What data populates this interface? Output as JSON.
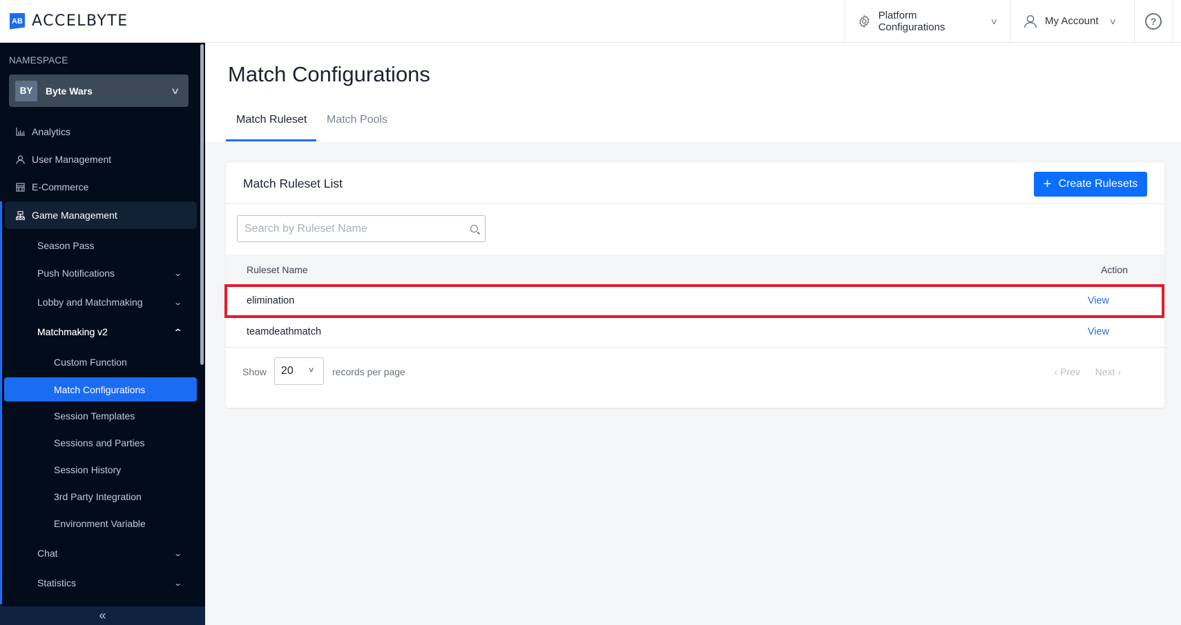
{
  "app": {
    "brand": "ACCELBYTE",
    "logo_mark": "AB"
  },
  "topbar": {
    "platform_configurations": "Platform Configurations",
    "my_account": "My Account",
    "help_icon": "?"
  },
  "sidebar": {
    "namespace_label": "NAMESPACE",
    "namespace": {
      "badge": "BY",
      "name": "Byte Wars"
    },
    "items": [
      {
        "label": "Analytics",
        "icon": "chart-icon"
      },
      {
        "label": "User Management",
        "icon": "user-icon"
      },
      {
        "label": "E-Commerce",
        "icon": "store-icon"
      },
      {
        "label": "Game Management",
        "icon": "sitemap-icon"
      }
    ],
    "game_management": [
      {
        "label": "Season Pass"
      },
      {
        "label": "Push Notifications"
      },
      {
        "label": "Lobby and Matchmaking"
      },
      {
        "label": "Matchmaking v2"
      },
      {
        "label": "Chat"
      },
      {
        "label": "Statistics"
      }
    ],
    "matchmaking_v2": [
      {
        "label": "Custom Function"
      },
      {
        "label": "Match Configurations"
      },
      {
        "label": "Session Templates"
      },
      {
        "label": "Sessions and Parties"
      },
      {
        "label": "Session History"
      },
      {
        "label": "3rd Party Integration"
      },
      {
        "label": "Environment Variable"
      }
    ],
    "collapse_glyph": "«"
  },
  "page": {
    "title": "Match Configurations",
    "tabs": [
      {
        "label": "Match Ruleset",
        "active": true
      },
      {
        "label": "Match Pools",
        "active": false
      }
    ]
  },
  "card": {
    "title": "Match Ruleset List",
    "create_button": "Create Rulesets",
    "search_placeholder": "Search by Ruleset Name",
    "search_value": "",
    "columns": {
      "name": "Ruleset Name",
      "action": "Action"
    },
    "rows": [
      {
        "name": "elimination",
        "action": "View",
        "highlighted": true
      },
      {
        "name": "teamdeathmatch",
        "action": "View",
        "highlighted": false
      }
    ],
    "pagination": {
      "show_label": "Show",
      "per_page": "20",
      "records_label": "records per page",
      "prev": "‹ Prev",
      "next": "Next ›"
    }
  },
  "colors": {
    "accent": "#1a6cf2",
    "sidebar_bg": "#020c1b",
    "highlight_border": "#e31c2a",
    "link": "#2f6de1"
  }
}
